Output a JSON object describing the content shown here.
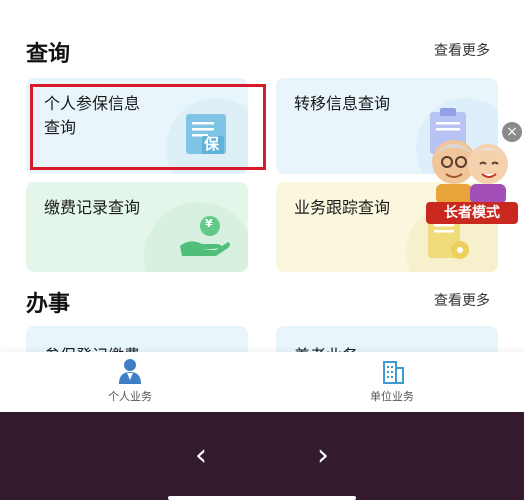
{
  "query_section": {
    "title": "查询",
    "more": "查看更多",
    "cards": [
      {
        "label": "个人参保信息查询",
        "icon": "document-icon",
        "badge": "保"
      },
      {
        "label": "转移信息查询",
        "icon": "clipboard-icon"
      },
      {
        "label": "缴费记录查询",
        "icon": "hand-coin-icon",
        "badge": "¥"
      },
      {
        "label": "业务跟踪查询",
        "icon": "doc-gear-icon"
      }
    ]
  },
  "handle_section": {
    "title": "办事",
    "more": "查看更多",
    "cards": [
      {
        "label": "参保登记缴费"
      },
      {
        "label": "养老业务"
      }
    ]
  },
  "elder_mode": {
    "label": "长者模式"
  },
  "tabbar": {
    "items": [
      {
        "label": "个人业务",
        "icon": "person-icon"
      },
      {
        "label": "单位业务",
        "icon": "building-icon"
      }
    ]
  },
  "colors": {
    "blue_card": "#e8f6fb",
    "green_card": "#e4f6ea",
    "yellow_card": "#fbf7df",
    "highlight_border": "#d8192a",
    "elder_badge": "#c8281e",
    "system_bar": "#331a2d"
  }
}
